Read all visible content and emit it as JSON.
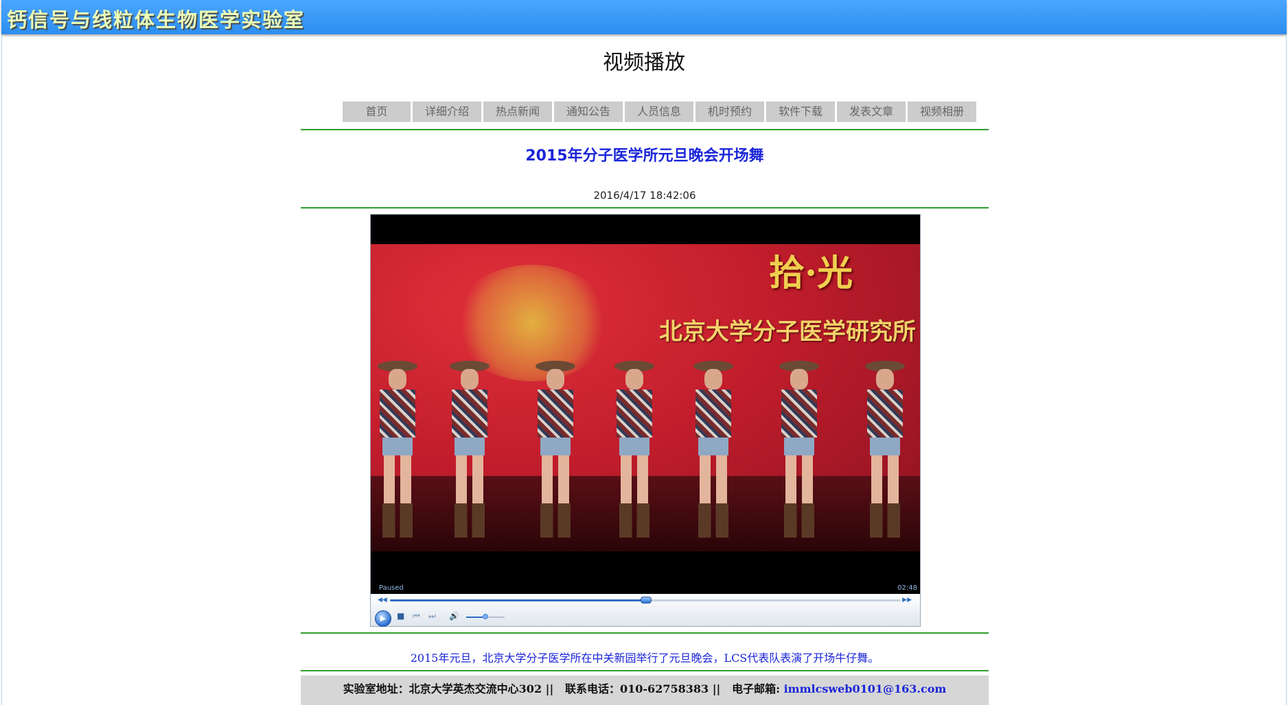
{
  "header": {
    "title": "钙信号与线粒体生物医学实验室"
  },
  "page": {
    "title": "视频播放"
  },
  "nav": {
    "items": [
      {
        "label": "首页"
      },
      {
        "label": "详细介绍"
      },
      {
        "label": "热点新闻"
      },
      {
        "label": "通知公告"
      },
      {
        "label": "人员信息"
      },
      {
        "label": "机时预约"
      },
      {
        "label": "软件下载"
      },
      {
        "label": "发表文章"
      },
      {
        "label": "视频相册"
      }
    ]
  },
  "article": {
    "title": "2015年分子医学所元旦晚会开场舞",
    "date": "2016/4/17 18:42:06",
    "description": "2015年元旦，北京大学分子医学所在中关新园举行了元旦晚会，LCS代表队表演了开场牛仔舞。"
  },
  "player": {
    "status": "Paused",
    "duration": "02:48",
    "progress_fraction": 0.5,
    "volume_fraction": 0.5,
    "overlay_line1": "拾·光",
    "overlay_line2": "北京大学分子医学研究所",
    "icons": {
      "play": "play-icon",
      "stop": "stop-icon",
      "previous": "previous-icon",
      "next": "next-icon",
      "volume": "volume-icon",
      "seek_back": "rewind-icon",
      "seek_fwd": "fast-forward-icon"
    }
  },
  "footer": {
    "address": "实验室地址：北京大学英杰交流中心302 ||",
    "phone": "联系电话：010-62758383 ||",
    "email_label": "电子邮箱:",
    "email": "immlcsweb0101@163.com"
  },
  "colors": {
    "banner": "#3399ff",
    "banner_title": "#e9ffb8",
    "accent_blue": "#1a25d8",
    "rule_green": "#2e9e2e",
    "nav_bg": "#cccccc"
  }
}
